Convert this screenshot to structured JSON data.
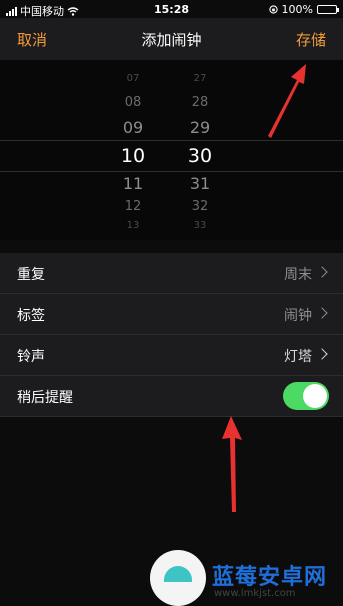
{
  "status_bar": {
    "carrier": "中国移动",
    "time": "15:28",
    "battery_percent": "100%",
    "battery_level": 1.0
  },
  "nav": {
    "cancel": "取消",
    "title": "添加闹钟",
    "save": "存储",
    "accent_color": "#f29c38"
  },
  "picker": {
    "hours": [
      "07",
      "08",
      "09",
      "10",
      "11",
      "12",
      "13"
    ],
    "minutes": [
      "27",
      "28",
      "29",
      "30",
      "31",
      "32",
      "33"
    ],
    "selected_hour": "10",
    "selected_minute": "30"
  },
  "settings": [
    {
      "label": "重复",
      "value": "周末",
      "type": "link"
    },
    {
      "label": "标签",
      "value": "闹钟",
      "type": "link"
    },
    {
      "label": "铃声",
      "value": "灯塔",
      "type": "link"
    },
    {
      "label": "稍后提醒",
      "type": "toggle",
      "on": true
    }
  ],
  "watermark": {
    "name": "蓝莓安卓网",
    "url": "www.lmkjst.com"
  },
  "colors": {
    "toggle_on": "#4cd964",
    "annotation_arrow": "#e8322f"
  }
}
